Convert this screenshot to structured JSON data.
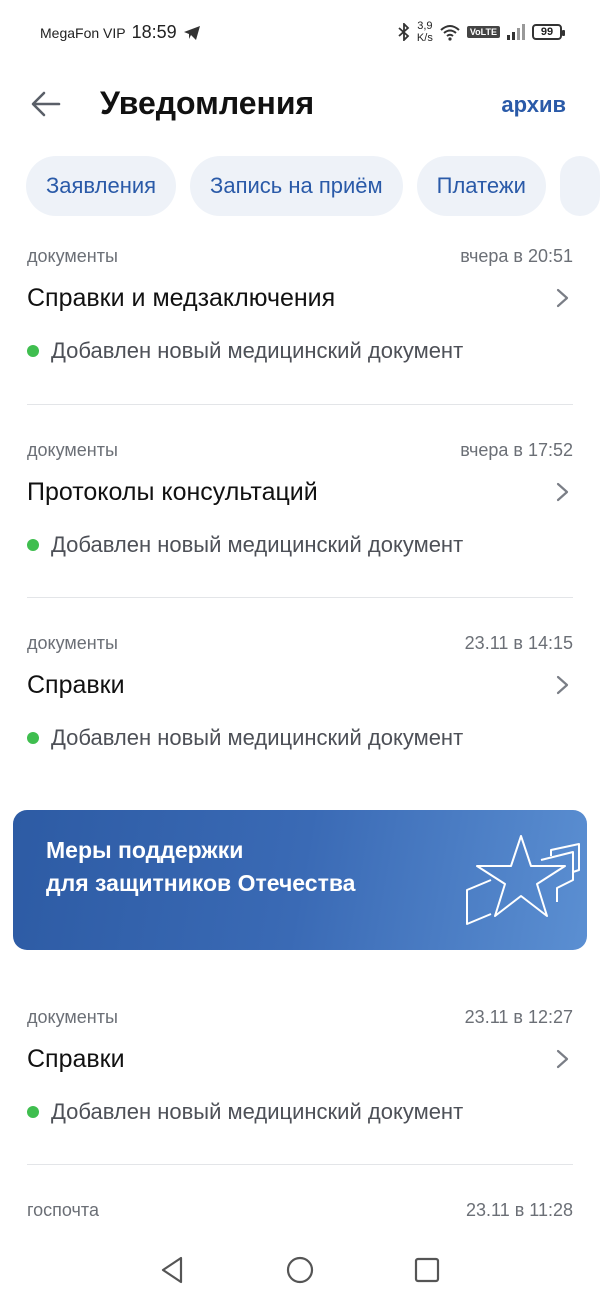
{
  "status_bar": {
    "carrier": "MegaFon VIP",
    "time": "18:59",
    "net_speed_value": "3,9",
    "net_speed_unit": "K/s",
    "volte": "VoLTE",
    "battery": "99"
  },
  "header": {
    "title": "Уведомления",
    "archive_label": "архив"
  },
  "filters": [
    "Заявления",
    "Запись на приём",
    "Платежи"
  ],
  "notifications": [
    {
      "category": "документы",
      "time": "вчера в 20:51",
      "title": "Справки и медзаключения",
      "status": "Добавлен новый медицинский документ"
    },
    {
      "category": "документы",
      "time": "вчера в 17:52",
      "title": "Протоколы консультаций",
      "status": "Добавлен новый медицинский документ"
    },
    {
      "category": "документы",
      "time": "23.11 в 14:15",
      "title": "Справки",
      "status": "Добавлен новый медицинский документ"
    },
    {
      "category": "документы",
      "time": "23.11 в 12:27",
      "title": "Справки",
      "status": "Добавлен новый медицинский документ"
    },
    {
      "category": "госпочта",
      "time": "23.11 в 11:28",
      "title": "",
      "status": ""
    }
  ],
  "banner": {
    "line1": "Меры поддержки",
    "line2": "для защитников Отечества"
  },
  "colors": {
    "accent": "#2a5aa8",
    "chip_bg": "#eef2f8",
    "status_dot": "#3fbe4f",
    "banner_start": "#2d5ba4",
    "banner_end": "#5b8fd2"
  }
}
